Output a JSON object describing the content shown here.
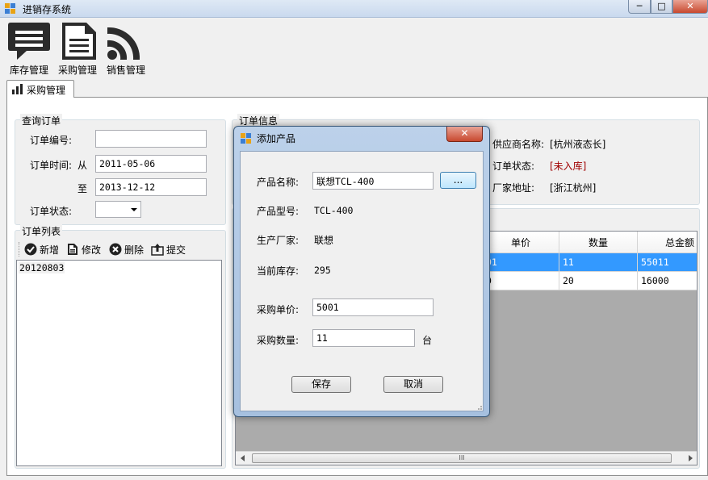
{
  "window": {
    "title": "进销存系统",
    "minimize": "─",
    "maximize": "□",
    "close": "✕"
  },
  "toolbar": {
    "items": [
      {
        "label": "库存管理",
        "icon": "speech-bubble-icon"
      },
      {
        "label": "采购管理",
        "icon": "document-icon"
      },
      {
        "label": "销售管理",
        "icon": "rss-icon"
      }
    ]
  },
  "tab": {
    "label": "采购管理",
    "icon": "bar-chart-icon"
  },
  "query": {
    "title": "查询订单",
    "order_no_label": "订单编号:",
    "order_no_value": "",
    "order_time_label": "订单时间:",
    "from_label": "从",
    "from_value": "2011-05-06",
    "to_label": "至",
    "to_value": "2013-12-12",
    "status_label": "订单状态:",
    "status_value": ""
  },
  "order_list": {
    "title": "订单列表",
    "tools": {
      "add": "新增",
      "edit": "修改",
      "delete": "删除",
      "submit": "提交"
    },
    "items": [
      "20120803"
    ]
  },
  "order_info": {
    "title": "订单信息",
    "supplier_label": "供应商名称:",
    "supplier_value": "[杭州液态长]",
    "status_label": "订单状态:",
    "status_value": "[未入库]",
    "address_label": "厂家地址:",
    "address_value": "[浙江杭州]"
  },
  "grid": {
    "columns": [
      "单价",
      "数量",
      "总金额"
    ],
    "rows": [
      {
        "price": "01",
        "qty": "11",
        "total": "55011",
        "selected": true
      },
      {
        "price": "0",
        "qty": "20",
        "total": "16000",
        "selected": false
      }
    ],
    "scroll_grip": "III"
  },
  "dialog": {
    "title": "添加产品",
    "close": "✕",
    "product_name_label": "产品名称:",
    "product_name_value": "联想TCL-400",
    "browse_label": "...",
    "model_label": "产品型号:",
    "model_value": "TCL-400",
    "maker_label": "生产厂家:",
    "maker_value": "联想",
    "stock_label": "当前库存:",
    "stock_value": "295",
    "price_label": "采购单价:",
    "price_value": "5001",
    "qty_label": "采购数量:",
    "qty_value": "11",
    "qty_unit": "台",
    "save_label": "保存",
    "cancel_label": "取消"
  }
}
